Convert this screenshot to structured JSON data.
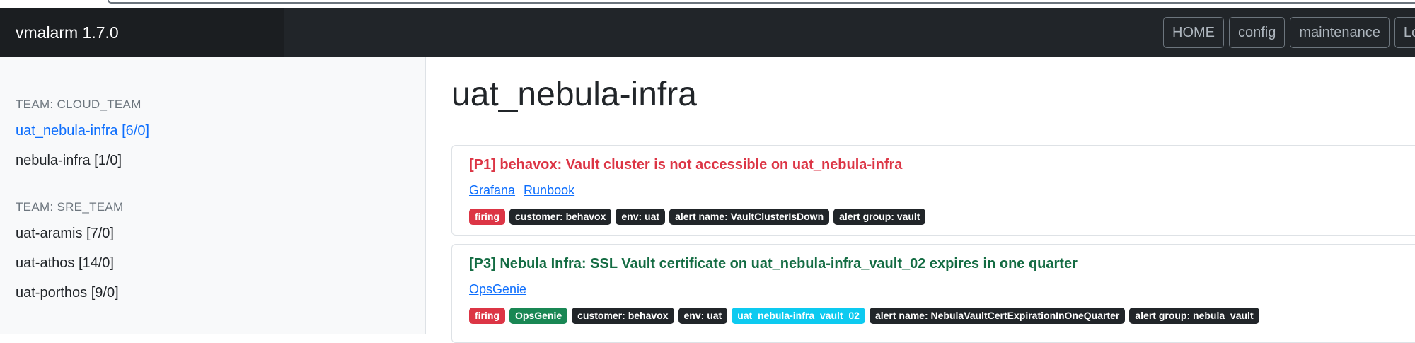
{
  "app": {
    "brand": "vmalarm 1.7.0"
  },
  "nav": {
    "items": [
      "HOME",
      "config",
      "maintenance",
      "Lo"
    ]
  },
  "sidebar": {
    "teams": [
      {
        "title": "TEAM: CLOUD_TEAM",
        "items": [
          {
            "label": "uat_nebula-infra [6/0]",
            "active": true
          },
          {
            "label": "nebula-infra [1/0]",
            "active": false
          }
        ]
      },
      {
        "title": "TEAM: SRE_TEAM",
        "items": [
          {
            "label": "uat-aramis [7/0]",
            "active": false
          },
          {
            "label": "uat-athos [14/0]",
            "active": false
          },
          {
            "label": "uat-porthos [9/0]",
            "active": false
          }
        ]
      }
    ]
  },
  "main": {
    "title": "uat_nebula-infra",
    "alerts": [
      {
        "title": "[P1] behavox: Vault cluster is not accessible on uat_nebula-infra",
        "priority": "P1",
        "links": [
          "Grafana",
          "Runbook"
        ],
        "badges": [
          {
            "text": "firing",
            "color": "#dc3545"
          },
          {
            "text": "customer: behavox",
            "color": "#212529"
          },
          {
            "text": "env: uat",
            "color": "#212529"
          },
          {
            "text": "alert name: VaultClusterIsDown",
            "color": "#212529"
          },
          {
            "text": "alert group: vault",
            "color": "#212529"
          }
        ]
      },
      {
        "title": "[P3] Nebula Infra: SSL Vault certificate on uat_nebula-infra_vault_02 expires in one quarter",
        "priority": "P3",
        "links": [
          "OpsGenie"
        ],
        "badges": [
          {
            "text": "firing",
            "color": "#dc3545"
          },
          {
            "text": "OpsGenie",
            "color": "#198754"
          },
          {
            "text": "customer: behavox",
            "color": "#212529"
          },
          {
            "text": "env: uat",
            "color": "#212529"
          },
          {
            "text": "uat_nebula-infra_vault_02",
            "color": "#0dcaf0"
          },
          {
            "text": "alert name: NebulaVaultCertExpirationInOneQuarter",
            "color": "#212529"
          },
          {
            "text": "alert group: nebula_vault",
            "color": "#212529"
          }
        ]
      }
    ]
  }
}
